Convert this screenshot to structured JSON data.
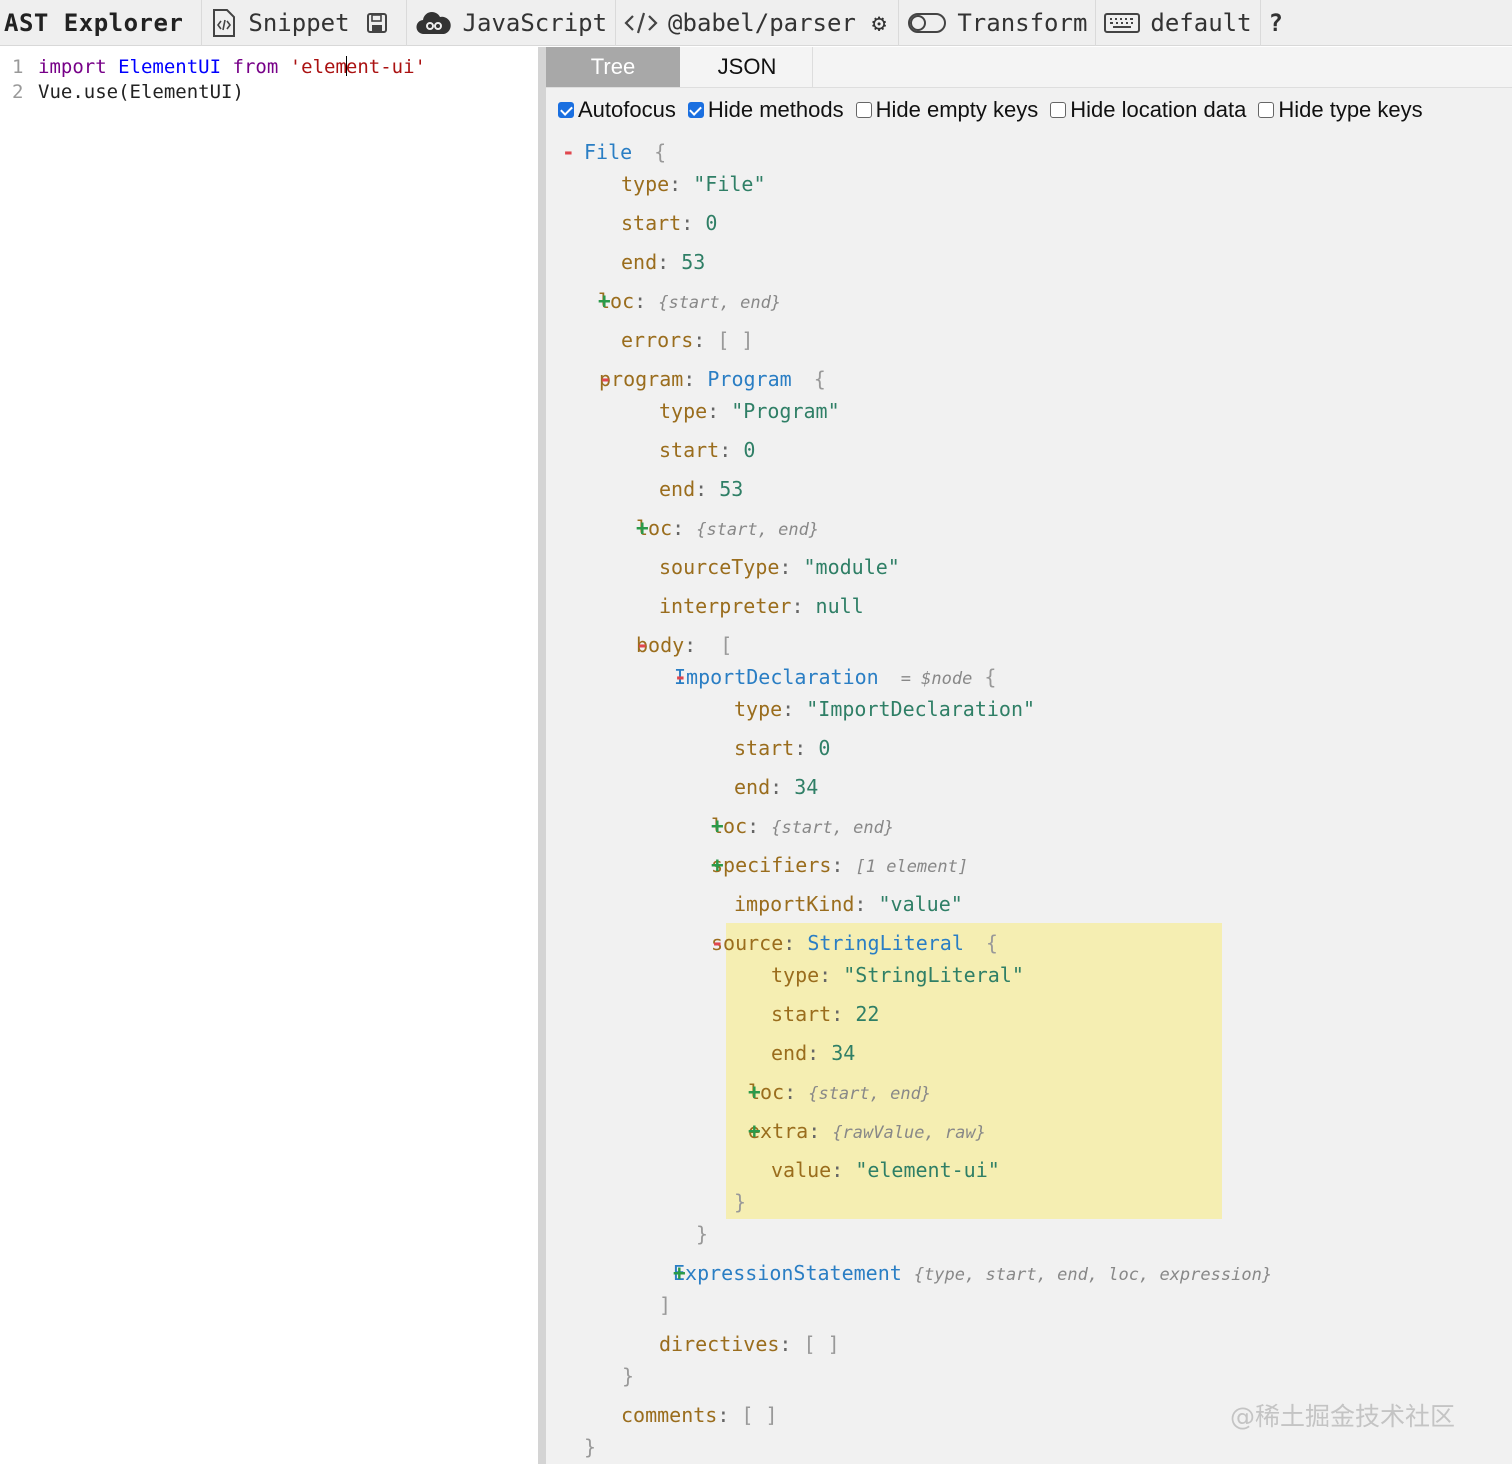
{
  "toolbar": {
    "title": "AST Explorer",
    "snippet": "Snippet",
    "language": "JavaScript",
    "parser": "@babel/parser",
    "transform": "Transform",
    "keymap": "default",
    "help": "?"
  },
  "editor": {
    "line1_no": "1",
    "line1_kw1": "import",
    "line1_id": "ElementUI",
    "line1_kw2": "from",
    "line1_str_a": "'elem",
    "line1_str_b": "ent-ui'",
    "line2_no": "2",
    "line2_code": "Vue.use(ElementUI)"
  },
  "tabs": {
    "tree": "Tree",
    "json": "JSON"
  },
  "options": {
    "autofocus": "Autofocus",
    "hide_methods": "Hide methods",
    "hide_empty": "Hide empty keys",
    "hide_location": "Hide location data",
    "hide_type": "Hide type keys",
    "autofocus_checked": true,
    "hide_methods_checked": true,
    "hide_empty_checked": false,
    "hide_location_checked": false,
    "hide_type_checked": false
  },
  "tree": {
    "file_label": "File",
    "open_brace": "{",
    "close_brace": "}",
    "open_bracket": "[",
    "close_bracket": "]",
    "empty_array": "[ ]",
    "colon": ":",
    "k_type": "type",
    "k_start": "start",
    "k_end": "end",
    "k_loc": "loc",
    "k_errors": "errors",
    "k_program": "program",
    "k_sourceType": "sourceType",
    "k_interpreter": "interpreter",
    "k_body": "body",
    "k_specifiers": "specifiers",
    "k_importKind": "importKind",
    "k_source": "source",
    "k_extra": "extra",
    "k_value": "value",
    "k_directives": "directives",
    "k_comments": "comments",
    "file_type": "\"File\"",
    "file_start": "0",
    "file_end": "53",
    "loc_summary": "{start, end}",
    "program_type_name": "Program",
    "program_type": "\"Program\"",
    "program_start": "0",
    "program_end": "53",
    "source_type": "\"module\"",
    "interpreter": "null",
    "import_decl": "ImportDeclaration",
    "node_ref": "= $node",
    "import_type": "\"ImportDeclaration\"",
    "import_start": "0",
    "import_end": "34",
    "specifiers_summary": "[1 element]",
    "import_kind": "\"value\"",
    "string_literal": "StringLiteral",
    "sl_type": "\"StringLiteral\"",
    "sl_start": "22",
    "sl_end": "34",
    "extra_summary": "{rawValue, raw}",
    "sl_value": "\"element-ui\"",
    "expr_stmt": "ExpressionStatement",
    "expr_summary": "{type, start, end, loc, expression}"
  },
  "watermark": "@稀土掘金技术社区",
  "colors": {
    "key": "#9a6d1d",
    "type_name": "#2a7ec4",
    "value": "#2f7f66",
    "highlight": "#f5eeb2",
    "minus": "#e0474e",
    "plus": "#2a9a4a"
  }
}
